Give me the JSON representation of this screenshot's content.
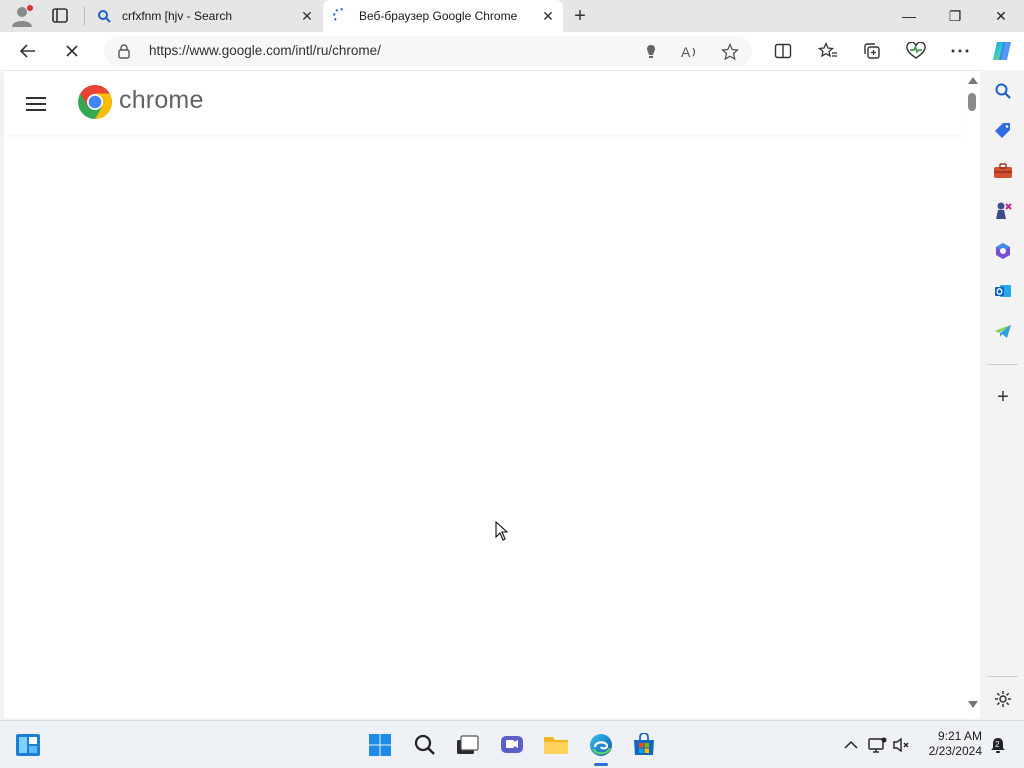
{
  "browser": {
    "tabs": [
      {
        "title": "crfxfnm [hjv - Search",
        "favicon": "search-icon",
        "close": "✕"
      },
      {
        "title": "Веб-браузер Google Chrome",
        "favicon": "loading-spinner-icon",
        "close": "✕"
      }
    ],
    "new_tab": "+",
    "window_controls": {
      "minimize": "—",
      "restore": "❐",
      "close": "✕"
    },
    "address": {
      "url": "https://www.google.com/intl/ru/chrome/"
    }
  },
  "page": {
    "logo_text": "chrome",
    "colors": {
      "red": "#ea4335",
      "yellow": "#fbbc05",
      "green": "#34a853",
      "blue": "#4285f4"
    }
  },
  "sidebar": {
    "items": [
      "search-icon",
      "shopping-tag-icon",
      "tools-icon",
      "games-icon",
      "microsoft-365-icon",
      "outlook-icon",
      "telegram-icon"
    ],
    "add": "+"
  },
  "taskbar": {
    "time": "9:21 AM",
    "date": "2/23/2024",
    "apps": [
      "widgets-icon",
      "start-icon",
      "search-icon",
      "task-view-icon",
      "chat-icon",
      "file-explorer-icon",
      "edge-icon",
      "store-icon"
    ]
  }
}
